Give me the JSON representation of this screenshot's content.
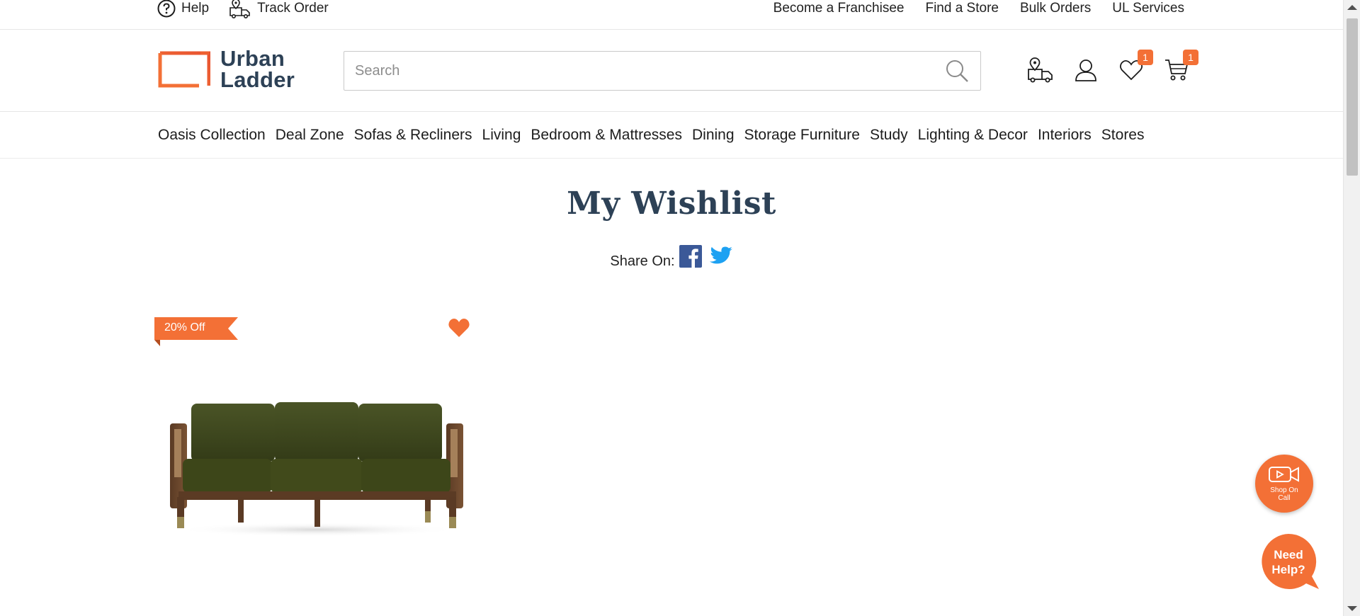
{
  "utility": {
    "help": "Help",
    "track_order": "Track Order",
    "links": [
      "Become a Franchisee",
      "Find a Store",
      "Bulk Orders",
      "UL Services"
    ]
  },
  "logo": {
    "line1": "Urban",
    "line2": "Ladder"
  },
  "search": {
    "placeholder": "Search",
    "value": ""
  },
  "header": {
    "wishlist_count": "1",
    "cart_count": "1"
  },
  "nav": [
    "Oasis Collection",
    "Deal Zone",
    "Sofas & Recliners",
    "Living",
    "Bedroom & Mattresses",
    "Dining",
    "Storage Furniture",
    "Study",
    "Lighting & Decor",
    "Interiors",
    "Stores"
  ],
  "page": {
    "title": "My Wishlist",
    "share_label": "Share On:"
  },
  "product": {
    "discount": "20% Off"
  },
  "floating": {
    "shop_on_call": "Shop On Call",
    "need_help_line1": "Need",
    "need_help_line2": "Help?"
  },
  "colors": {
    "accent": "#f37036",
    "brand_text": "#2d4156",
    "facebook": "#3b5998",
    "twitter": "#1da1f2"
  },
  "icons": [
    "help-icon",
    "track-order-icon",
    "search-icon",
    "store-delivery-icon",
    "user-icon",
    "wishlist-heart-icon",
    "cart-icon",
    "facebook-icon",
    "twitter-icon",
    "heart-icon",
    "video-call-icon"
  ]
}
